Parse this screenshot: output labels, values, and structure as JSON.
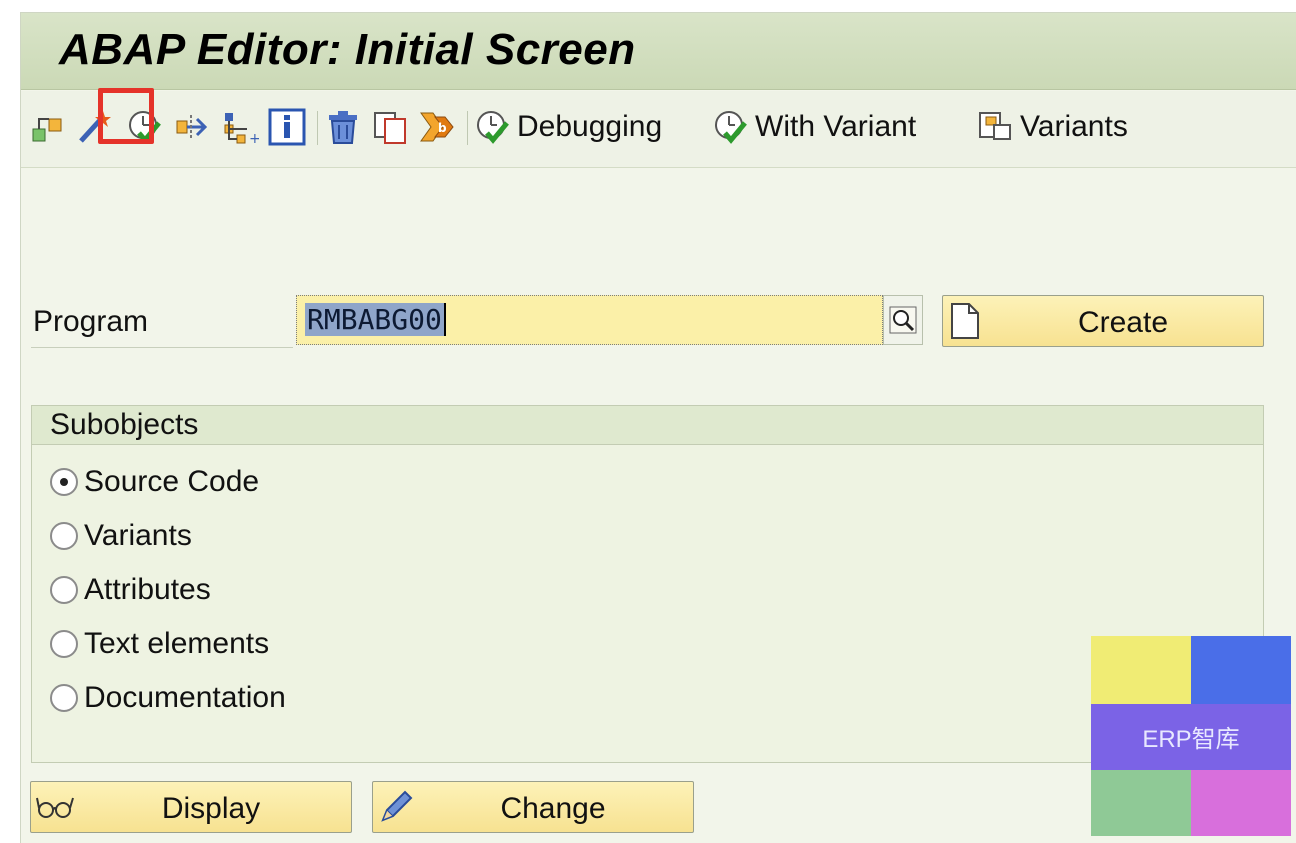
{
  "window": {
    "title": "ABAP Editor: Initial Screen"
  },
  "toolbar": {
    "icons": [
      "object-list-icon",
      "magic-wand-icon",
      "direct-processing-icon",
      "where-used-icon",
      "hierarchy-icon",
      "info-icon",
      "delete-icon",
      "copy-icon",
      "rename-icon"
    ],
    "debugging_label": "Debugging",
    "with_variant_label": "With Variant",
    "variants_label": "Variants"
  },
  "program": {
    "label": "Program",
    "value": "RMBABG00",
    "create_label": "Create"
  },
  "subobjects": {
    "title": "Subobjects",
    "options": [
      {
        "label": "Source Code",
        "checked": true
      },
      {
        "label": "Variants",
        "checked": false
      },
      {
        "label": "Attributes",
        "checked": false
      },
      {
        "label": "Text elements",
        "checked": false
      },
      {
        "label": "Documentation",
        "checked": false
      }
    ]
  },
  "actions": {
    "display_label": "Display",
    "change_label": "Change"
  },
  "watermark": {
    "text": "ERP智库",
    "colors": [
      "#f0ec74",
      "#4a6ee8",
      "#7b63e6",
      "#8fc996",
      "#d86fdc"
    ]
  }
}
